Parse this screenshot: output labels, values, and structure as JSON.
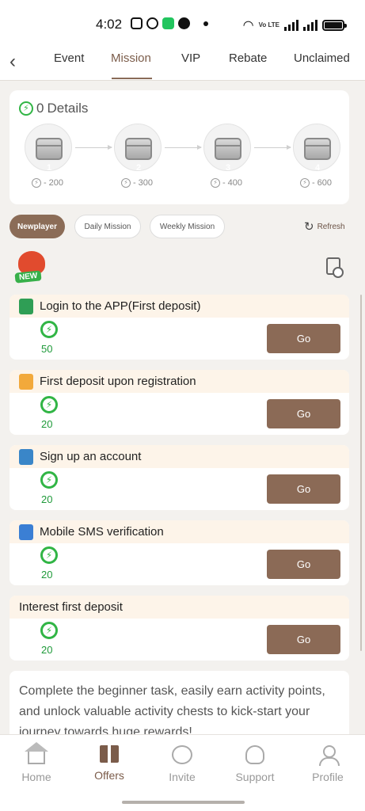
{
  "status_bar": {
    "time": "4:02",
    "network_label": "Vo LTE"
  },
  "tabs": [
    {
      "label": "Event"
    },
    {
      "label": "Mission",
      "active": true
    },
    {
      "label": "VIP"
    },
    {
      "label": "Rebate"
    },
    {
      "label": "Unclaimed"
    }
  ],
  "details": {
    "points": "0",
    "title": "Details",
    "chests": [
      {
        "number": "1",
        "points": "200"
      },
      {
        "number": "2",
        "points": "300"
      },
      {
        "number": "3",
        "points": "400"
      },
      {
        "number": "4",
        "points": "600"
      }
    ]
  },
  "filters": [
    {
      "label": "Newplayer",
      "active": true
    },
    {
      "label": "Daily Mission",
      "active": false
    },
    {
      "label": "Weekly Mission",
      "active": false
    }
  ],
  "refresh_label": "Refresh",
  "new_badge": "NEW",
  "missions": [
    {
      "title": "Login to the APP(First deposit)",
      "points": "50",
      "button": "Go",
      "icon": "phone-login-icon",
      "icon_color": "#2f9e55"
    },
    {
      "title": "First deposit upon registration",
      "points": "20",
      "button": "Go",
      "icon": "wallet-icon",
      "icon_color": "#f2a93b"
    },
    {
      "title": "Sign up an account",
      "points": "20",
      "button": "Go",
      "icon": "clipboard-icon",
      "icon_color": "#3a86c8"
    },
    {
      "title": "Mobile SMS verification",
      "points": "20",
      "button": "Go",
      "icon": "mobile-icon",
      "icon_color": "#3b7fd4"
    },
    {
      "title": "Interest first deposit",
      "points": "20",
      "button": "Go",
      "icon": "",
      "icon_color": ""
    }
  ],
  "intro_text": "Complete the beginner task, easily earn activity points, and unlock valuable activity chests to kick-start your journey towards huge rewards!",
  "bottom_nav": [
    {
      "label": "Home",
      "icon": "home-icon"
    },
    {
      "label": "Offers",
      "icon": "gift-icon",
      "active": true
    },
    {
      "label": "Invite",
      "icon": "invite-icon"
    },
    {
      "label": "Support",
      "icon": "headset-icon"
    },
    {
      "label": "Profile",
      "icon": "profile-icon"
    }
  ],
  "colors": {
    "accent": "#8b6a56",
    "points_green": "#1f9a3a",
    "mission_header": "#fdf4e9"
  }
}
